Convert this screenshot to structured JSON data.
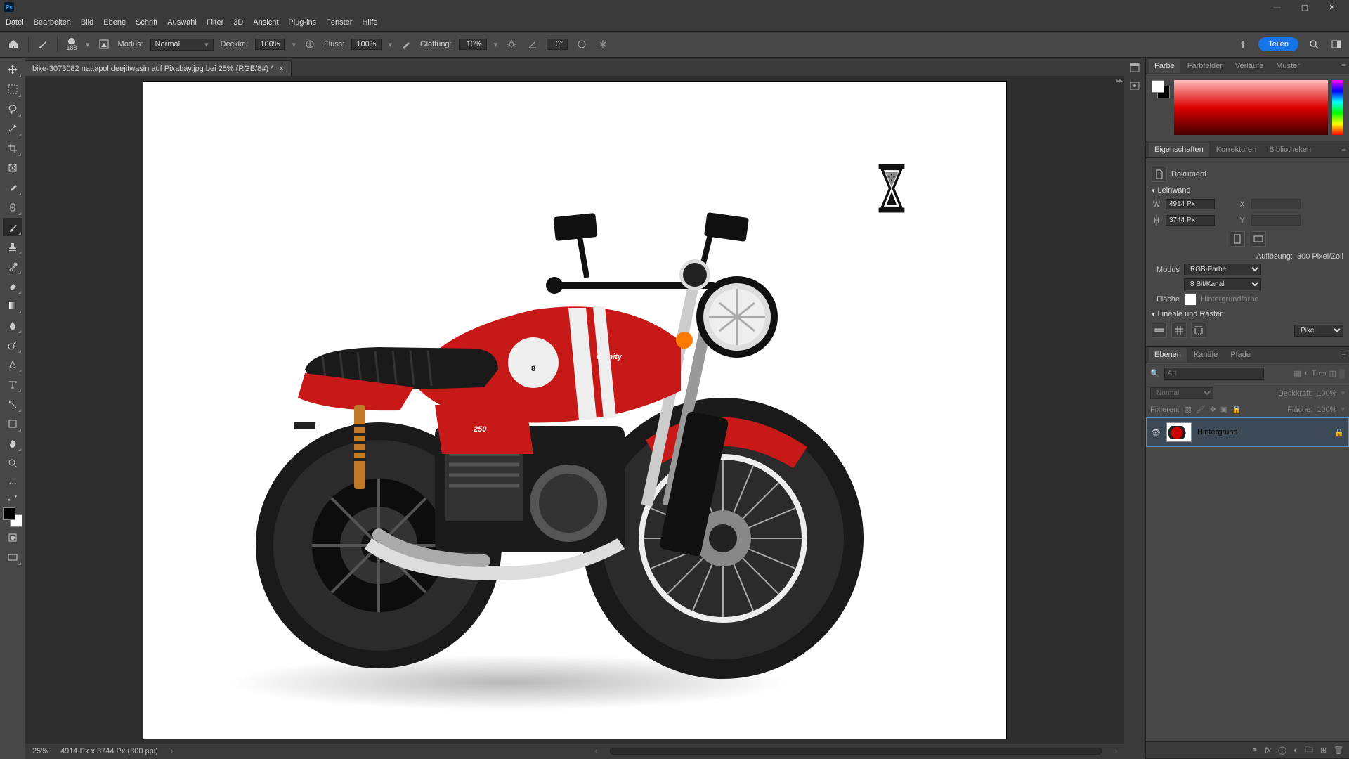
{
  "menu": [
    "Datei",
    "Bearbeiten",
    "Bild",
    "Ebene",
    "Schrift",
    "Auswahl",
    "Filter",
    "3D",
    "Ansicht",
    "Plug-ins",
    "Fenster",
    "Hilfe"
  ],
  "options": {
    "brush_size": "188",
    "modus_label": "Modus:",
    "modus_value": "Normal",
    "deckkraft_label": "Deckkr.:",
    "deckkraft_value": "100%",
    "fluss_label": "Fluss:",
    "fluss_value": "100%",
    "glattung_label": "Glättung:",
    "glattung_value": "10%",
    "angle_value": "0°",
    "teilen": "Teilen"
  },
  "doc_tab": {
    "title": "bike-3073082 nattapol deejitwasin auf Pixabay.jpg bei 25% (RGB/8#) *"
  },
  "status": {
    "zoom": "25%",
    "info": "4914 Px x 3744 Px (300 ppi)"
  },
  "panels": {
    "color_tabs": [
      "Farbe",
      "Farbfelder",
      "Verläufe",
      "Muster"
    ],
    "props_tabs": [
      "Eigenschaften",
      "Korrekturen",
      "Bibliotheken"
    ],
    "layer_tabs": [
      "Ebenen",
      "Kanäle",
      "Pfade"
    ]
  },
  "properties": {
    "doc_label": "Dokument",
    "leinwand": "Leinwand",
    "W_label": "W",
    "W_value": "4914 Px",
    "X_label": "X",
    "H_label": "H",
    "H_value": "3744 Px",
    "Y_label": "Y",
    "res_label": "Auflösung:",
    "res_value": "300 Pixel/Zoll",
    "modus_label": "Modus",
    "modus_value": "RGB-Farbe",
    "depth_value": "8 Bit/Kanal",
    "fill_label": "Fläche",
    "fill_value": "Hintergrundfarbe",
    "ruler_label": "Lineale und Raster",
    "unit_value": "Pixel"
  },
  "layers": {
    "search_placeholder": "Art",
    "blend_value": "Normal",
    "opacity_label": "Deckkraft:",
    "opacity_value": "100%",
    "lock_label": "Fixieren:",
    "fill_label": "Fläche:",
    "fill_value": "100%",
    "background_layer": "Hintergrund"
  }
}
